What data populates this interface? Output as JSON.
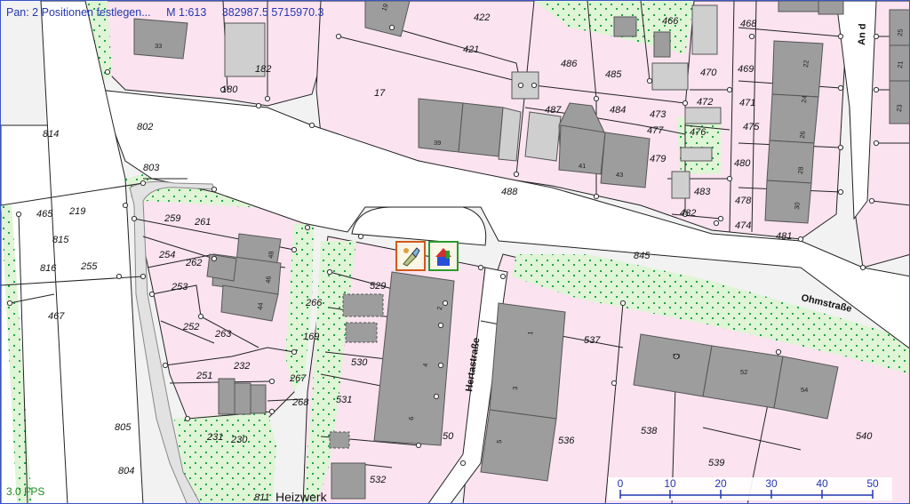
{
  "status": {
    "mode_text": "Pan: 2 Positionen festlegen...",
    "scale_text": "M 1:613",
    "coords_text": "382987.5 5715970.3"
  },
  "fps_text": "3.0 FPS",
  "colors": {
    "parcel": "#fbe3f0",
    "green": "#dff5d6",
    "road": "#ffffff",
    "building": "#9d9d9d",
    "accent": "#2436b0"
  },
  "streets": {
    "ohmstrasse": "Ohmstraße",
    "hertastrasse": "Hertastraße",
    "an_der": "An d",
    "heizwerk": "Heizwerk"
  },
  "tools": [
    {
      "name": "brush-tool",
      "icon": "brush-icon"
    },
    {
      "name": "paint-tool",
      "icon": "paint-house-icon"
    }
  ],
  "scale_bar": {
    "ticks": [
      "0",
      "10",
      "20",
      "30",
      "40",
      "50"
    ]
  },
  "parcel_labels": [
    {
      "text": "422"
    },
    {
      "text": "466"
    },
    {
      "text": "468"
    },
    {
      "text": "421"
    },
    {
      "text": "486"
    },
    {
      "text": "485"
    },
    {
      "text": "470"
    },
    {
      "text": "469"
    },
    {
      "text": "17"
    },
    {
      "text": "182"
    },
    {
      "text": "180"
    },
    {
      "text": "814"
    },
    {
      "text": "802"
    },
    {
      "text": "487"
    },
    {
      "text": "484"
    },
    {
      "text": "473"
    },
    {
      "text": "472"
    },
    {
      "text": "471"
    },
    {
      "text": "477"
    },
    {
      "text": "476"
    },
    {
      "text": "475"
    },
    {
      "text": "479"
    },
    {
      "text": "480"
    },
    {
      "text": "803"
    },
    {
      "text": "488"
    },
    {
      "text": "483"
    },
    {
      "text": "478"
    },
    {
      "text": "482"
    },
    {
      "text": "474"
    },
    {
      "text": "481"
    },
    {
      "text": "465"
    },
    {
      "text": "219"
    },
    {
      "text": "259"
    },
    {
      "text": "261"
    },
    {
      "text": "815"
    },
    {
      "text": "816"
    },
    {
      "text": "255"
    },
    {
      "text": "254"
    },
    {
      "text": "262"
    },
    {
      "text": "253"
    },
    {
      "text": "845"
    },
    {
      "text": "529"
    },
    {
      "text": "266"
    },
    {
      "text": "467"
    },
    {
      "text": "252"
    },
    {
      "text": "263"
    },
    {
      "text": "169"
    },
    {
      "text": "537"
    },
    {
      "text": "530"
    },
    {
      "text": "251"
    },
    {
      "text": "232"
    },
    {
      "text": "267"
    },
    {
      "text": "531"
    },
    {
      "text": "268"
    },
    {
      "text": "805"
    },
    {
      "text": "231"
    },
    {
      "text": "230"
    },
    {
      "text": "50"
    },
    {
      "text": "536"
    },
    {
      "text": "538"
    },
    {
      "text": "540"
    },
    {
      "text": "539"
    },
    {
      "text": "804"
    },
    {
      "text": "532"
    },
    {
      "text": "811"
    }
  ],
  "house_numbers": [
    {
      "text": "33"
    },
    {
      "text": "22"
    },
    {
      "text": "24"
    },
    {
      "text": "21"
    },
    {
      "text": "23"
    },
    {
      "text": "39"
    },
    {
      "text": "41"
    },
    {
      "text": "43"
    },
    {
      "text": "26"
    },
    {
      "text": "28"
    },
    {
      "text": "30"
    },
    {
      "text": "48"
    },
    {
      "text": "46"
    },
    {
      "text": "44"
    },
    {
      "text": "2"
    },
    {
      "text": "4"
    },
    {
      "text": "6"
    },
    {
      "text": "1"
    },
    {
      "text": "3"
    },
    {
      "text": "5"
    },
    {
      "text": "50"
    },
    {
      "text": "52"
    },
    {
      "text": "54"
    },
    {
      "text": "19"
    },
    {
      "text": "25"
    }
  ]
}
